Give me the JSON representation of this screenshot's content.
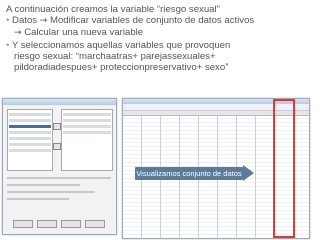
{
  "slide": {
    "title_line": "A continuación creamos la variable “riesgo sexual”",
    "bullet1_a": "Datos",
    "bullet1_b": "Modificar variables de conjunto de datos activos",
    "bullet1_c": "Calcular una nueva variable",
    "bullet2_l1": "Y seleccionamos aquellas variables que provoquen",
    "bullet2_l2": "riesgo sexual: “marchaatras+ parejassexuales+",
    "bullet2_l3": "pildoradiadespues+ proteccionpreservativo+ sexo”",
    "bullet_char": "•",
    "arrow_char": "→"
  },
  "callout": {
    "label": "Visualizamos conjunto de datos"
  },
  "colors": {
    "highlight": "#e23a2a",
    "callout_bg": "#5b7b9a"
  }
}
